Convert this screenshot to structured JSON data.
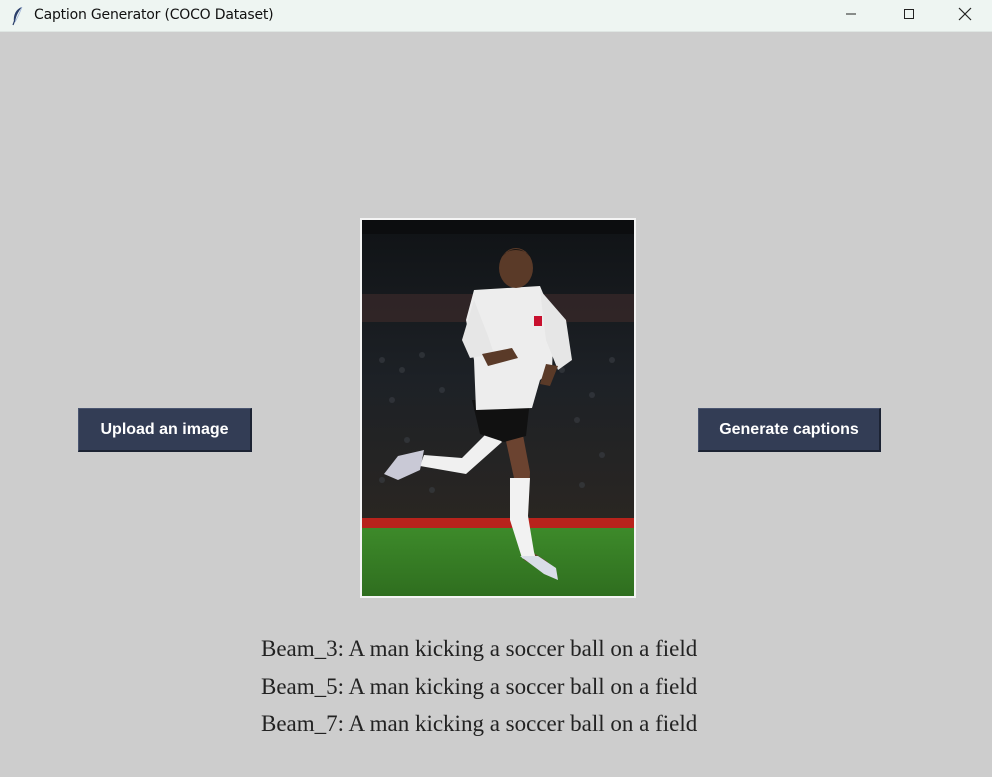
{
  "window": {
    "title": "Caption Generator (COCO Dataset)",
    "icon": "feather-icon",
    "controls": [
      "minimize-icon",
      "maximize-icon",
      "close-icon"
    ]
  },
  "buttons": {
    "upload_label": "Upload an image",
    "generate_label": "Generate captions"
  },
  "image": {
    "description_icon": "uploaded-photo"
  },
  "captions": [
    {
      "label": "Beam_3: A man kicking a soccer ball on a field"
    },
    {
      "label": "Beam_5: A man kicking a soccer ball on a field"
    },
    {
      "label": "Beam_7: A man kicking a soccer ball on a field"
    }
  ],
  "colors": {
    "background": "#cdcdcd",
    "button_bg": "#333d55",
    "button_text": "#ffffff",
    "titlebar": "#eef5f2"
  }
}
